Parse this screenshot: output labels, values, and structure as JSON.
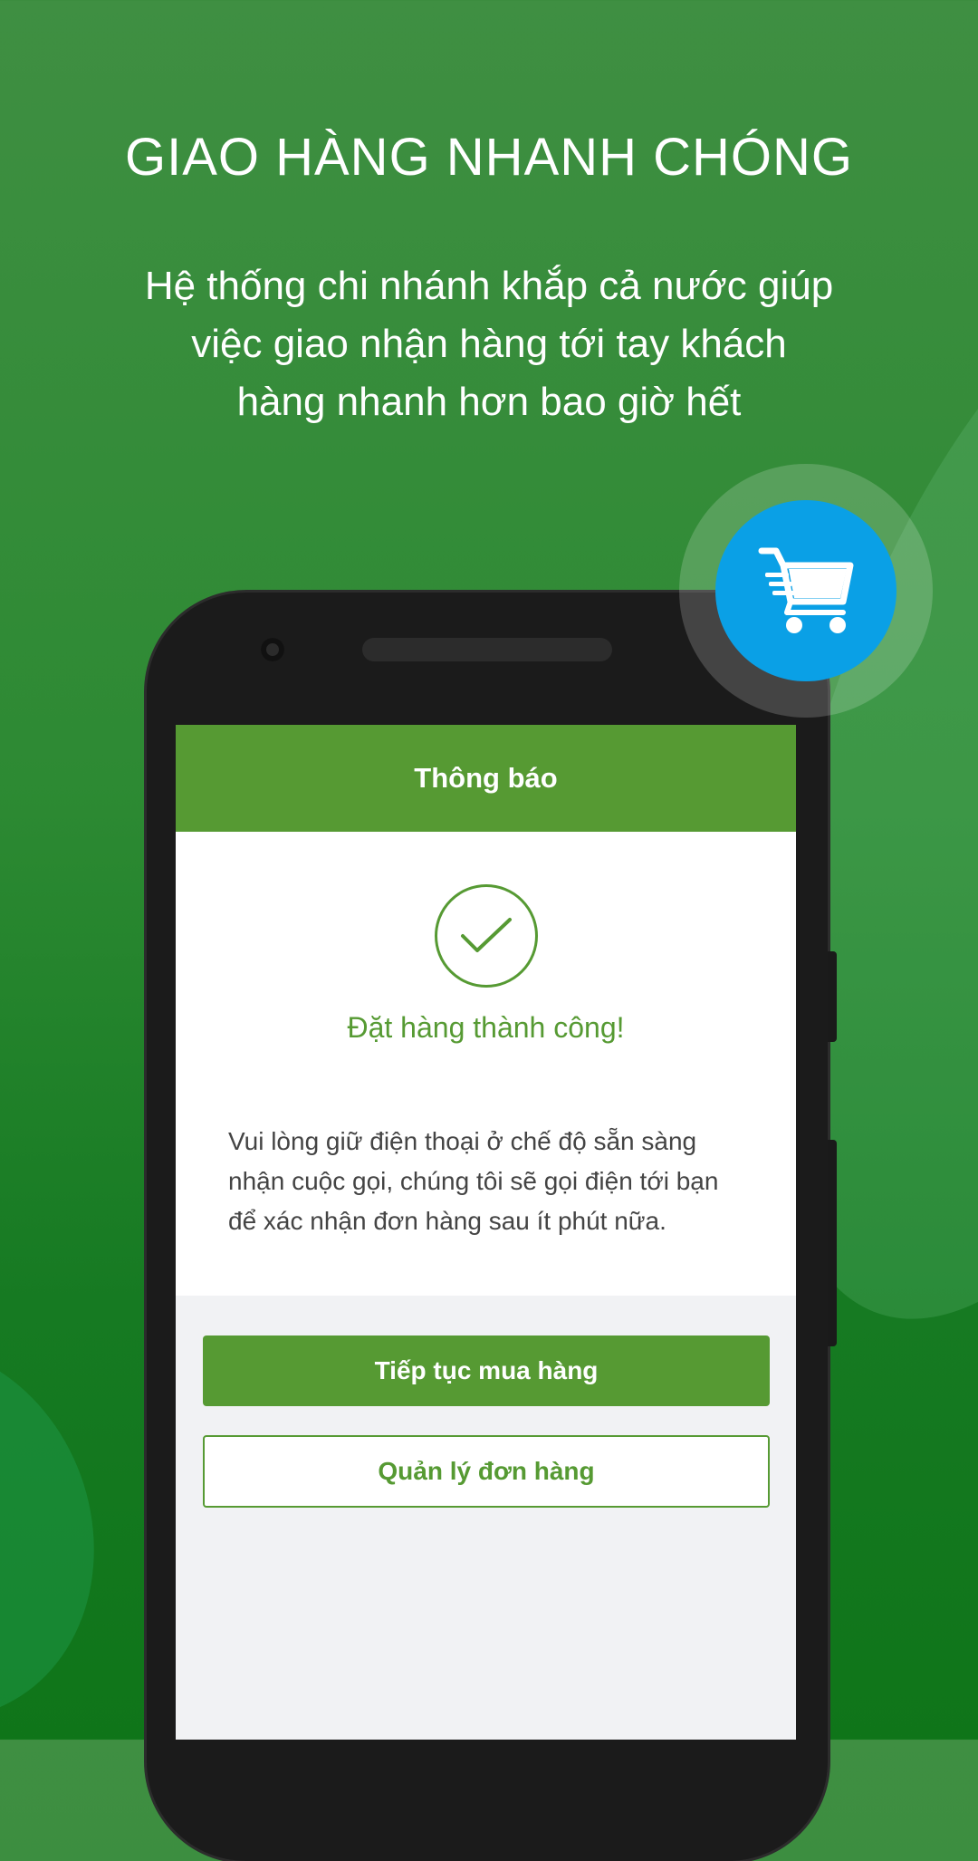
{
  "hero": {
    "headline": "GIAO HÀNG NHANH CHÓNG",
    "subtitle_lines": [
      "Hệ thống chi nhánh khắp cả nước giúp",
      "việc giao nhận hàng tới tay khách",
      "hàng nhanh hơn bao giờ hết"
    ]
  },
  "dialog": {
    "header_title": "Thông báo",
    "success_text": "Đặt hàng thành công!",
    "message_lines": [
      "Vui lòng giữ điện thoại ở chế độ sẵn sàng",
      "nhận cuộc gọi, chúng tôi sẽ gọi điện tới bạn",
      "để xác nhận đơn hàng sau ít phút nữa."
    ],
    "continue_label": "Tiếp tục mua hàng",
    "manage_label": "Quản lý đơn hàng"
  },
  "icons": {
    "check": "check-icon",
    "cart": "shopping-cart-icon"
  },
  "colors": {
    "brand_green": "#569a33",
    "cart_blue": "#0aa0e6",
    "background_green": "#2d8a33"
  }
}
